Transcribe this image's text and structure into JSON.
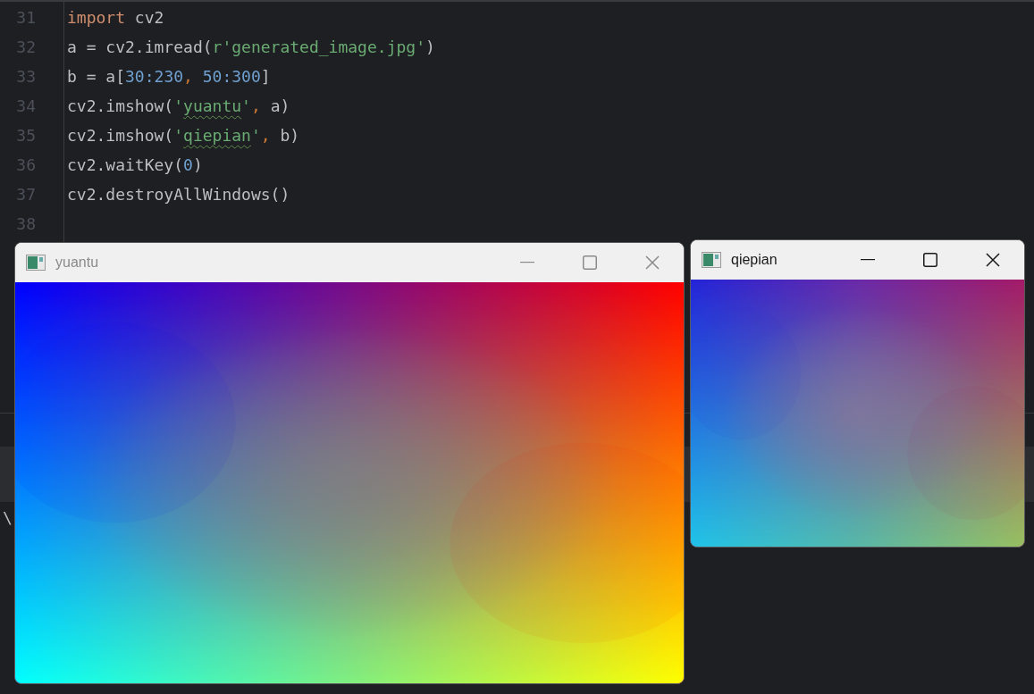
{
  "editor": {
    "lines": [
      {
        "number": "31",
        "tokens": [
          {
            "text": "import",
            "kind": "keyword"
          },
          {
            "text": " cv2",
            "kind": "plain"
          }
        ]
      },
      {
        "number": "32",
        "tokens": [
          {
            "text": "a = cv2.imread(",
            "kind": "plain"
          },
          {
            "text": "r'generated_image.jpg'",
            "kind": "string"
          },
          {
            "text": ")",
            "kind": "plain"
          }
        ]
      },
      {
        "number": "33",
        "tokens": [
          {
            "text": "b = a[",
            "kind": "plain"
          },
          {
            "text": "30:230",
            "kind": "number"
          },
          {
            "text": ", ",
            "kind": "punct"
          },
          {
            "text": "50:300",
            "kind": "number"
          },
          {
            "text": "]",
            "kind": "plain"
          }
        ]
      },
      {
        "number": "34",
        "tokens": [
          {
            "text": "cv2.imshow(",
            "kind": "plain"
          },
          {
            "text": "'",
            "kind": "string"
          },
          {
            "text": "yuantu",
            "kind": "typo"
          },
          {
            "text": "'",
            "kind": "string"
          },
          {
            "text": ", ",
            "kind": "punct"
          },
          {
            "text": "a)",
            "kind": "plain"
          }
        ]
      },
      {
        "number": "35",
        "tokens": [
          {
            "text": "cv2.imshow(",
            "kind": "plain"
          },
          {
            "text": "'",
            "kind": "string"
          },
          {
            "text": "qiepian",
            "kind": "typo"
          },
          {
            "text": "'",
            "kind": "string"
          },
          {
            "text": ", ",
            "kind": "punct"
          },
          {
            "text": "b)",
            "kind": "plain"
          }
        ]
      },
      {
        "number": "36",
        "tokens": [
          {
            "text": "cv2.waitKey(",
            "kind": "plain"
          },
          {
            "text": "0",
            "kind": "number"
          },
          {
            "text": ")",
            "kind": "plain"
          }
        ]
      },
      {
        "number": "37",
        "tokens": [
          {
            "text": "cv2.destroyAllWindows()",
            "kind": "plain"
          }
        ]
      },
      {
        "number": "38"
      }
    ]
  },
  "lower_panel": {
    "fragment": "\\"
  },
  "windows": [
    {
      "title": "yuantu",
      "active": false
    },
    {
      "title": "qiepian",
      "active": true
    }
  ]
}
